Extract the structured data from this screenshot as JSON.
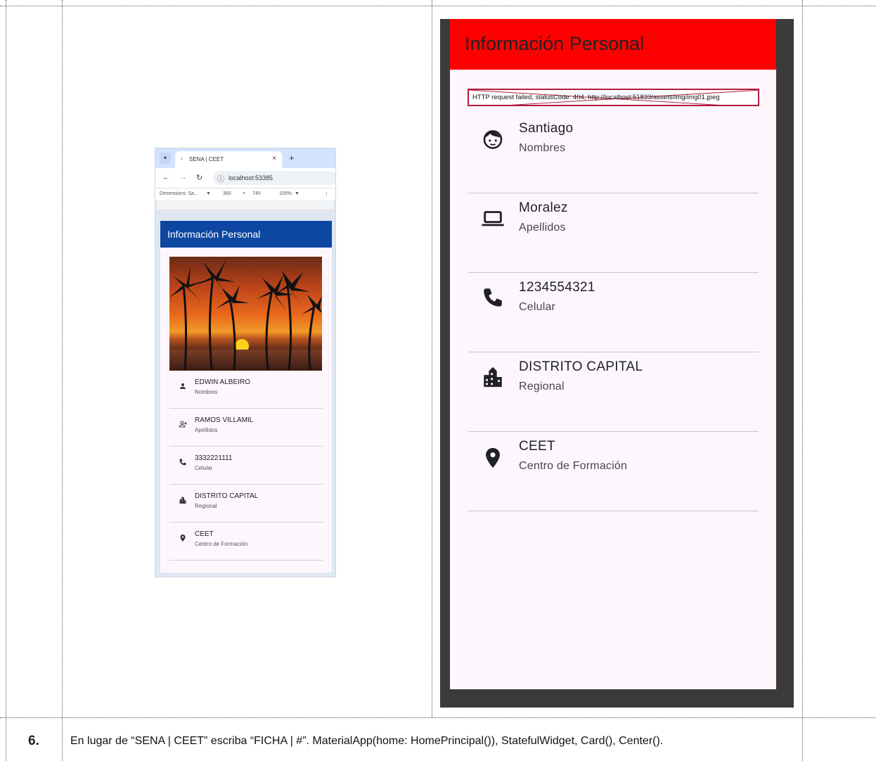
{
  "browser": {
    "tab_title": "SENA | CEET",
    "tab_close": "×",
    "new_tab": "+",
    "url": "localhost:53385",
    "devtools": {
      "dimensions": "Dimensions: Sa...",
      "width": "360",
      "times": "×",
      "height": "740",
      "zoom": "100%"
    },
    "app": {
      "title": "Información Personal",
      "items": [
        {
          "title": "EDWIN ALBEIRO",
          "subtitle": "Nombres",
          "icon": "person-icon"
        },
        {
          "title": "RAMOS VILLAMIL",
          "subtitle": "Apellidos",
          "icon": "person-add-icon"
        },
        {
          "title": "3332221111",
          "subtitle": "Celular",
          "icon": "phone-icon"
        },
        {
          "title": "DISTRITO CAPITAL",
          "subtitle": "Regional",
          "icon": "city-icon"
        },
        {
          "title": "CEET",
          "subtitle": "Centro de Formación",
          "icon": "location-pin-icon"
        }
      ]
    }
  },
  "phone": {
    "title": "Información Personal",
    "error": "HTTP request failed, statusCode: 404, http://localhost:51833/assets/img/img01.jpeg",
    "items": [
      {
        "title": "Santiago",
        "subtitle": "Nombres",
        "icon": "face-icon"
      },
      {
        "title": "Moralez",
        "subtitle": "Apellidos",
        "icon": "laptop-icon"
      },
      {
        "title": "1234554321",
        "subtitle": "Celular",
        "icon": "phone-icon"
      },
      {
        "title": "DISTRITO CAPITAL",
        "subtitle": "Regional",
        "icon": "city-icon"
      },
      {
        "title": "CEET",
        "subtitle": "Centro de Formación",
        "icon": "location-pin-icon"
      }
    ]
  },
  "row": {
    "number": "6.",
    "instruction": "En lugar de “SENA | CEET” escriba “FICHA | #”. MaterialApp(home: HomePrincipal()), StatefulWidget, Card(), Center()."
  }
}
